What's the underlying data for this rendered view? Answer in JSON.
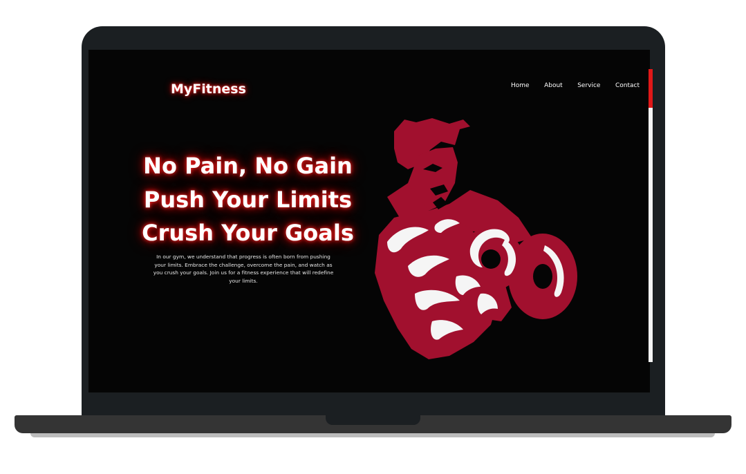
{
  "site": {
    "logo": "MyFitness",
    "nav": {
      "home": "Home",
      "about": "About",
      "service": "Service",
      "contact": "Contact"
    }
  },
  "hero": {
    "headline": [
      "No Pain, No Gain",
      "Push Your Limits",
      "Crush Your Goals"
    ],
    "description": "In our gym, we understand that progress is often born from pushing your limits. Embrace the challenge, overcome the pain, and watch as you crush your goals. Join us for a fitness experience that will redefine your limits.",
    "illustration": "bodybuilder-dumbbell-illustration"
  },
  "colors": {
    "background": "#050505",
    "accent": "#a1102e",
    "glow": "#ff2a2a",
    "text": "#ffffff",
    "scrollbar_thumb": "#e11818"
  }
}
